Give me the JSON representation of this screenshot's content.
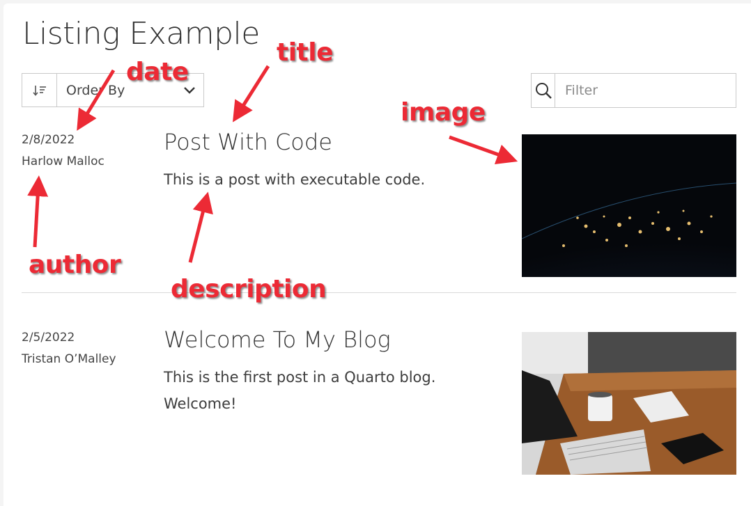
{
  "page": {
    "title": "Listing Example"
  },
  "toolbar": {
    "sort_icon": "sort-descending-icon",
    "sort_label": "Order By",
    "sort_chevron": "chevron-down-icon",
    "filter_icon": "search-icon",
    "filter_placeholder": "Filter"
  },
  "posts": [
    {
      "date": "2/8/2022",
      "author": "Harlow Malloc",
      "title": "Post With Code",
      "description": "This is a post with executable code.",
      "image": "earth-at-night-image"
    },
    {
      "date": "2/5/2022",
      "author": "Tristan O’Malley",
      "title": "Welcome To My Blog",
      "description": "This is the first post in a Quarto blog. Welcome!",
      "image": "laptop-desk-image"
    }
  ],
  "annotations": {
    "date": "date",
    "title": "title",
    "image": "image",
    "author": "author",
    "description": "description"
  },
  "colors": {
    "annotation": "#ec2a35",
    "border": "#c9c9c9",
    "text": "#373a3c"
  }
}
